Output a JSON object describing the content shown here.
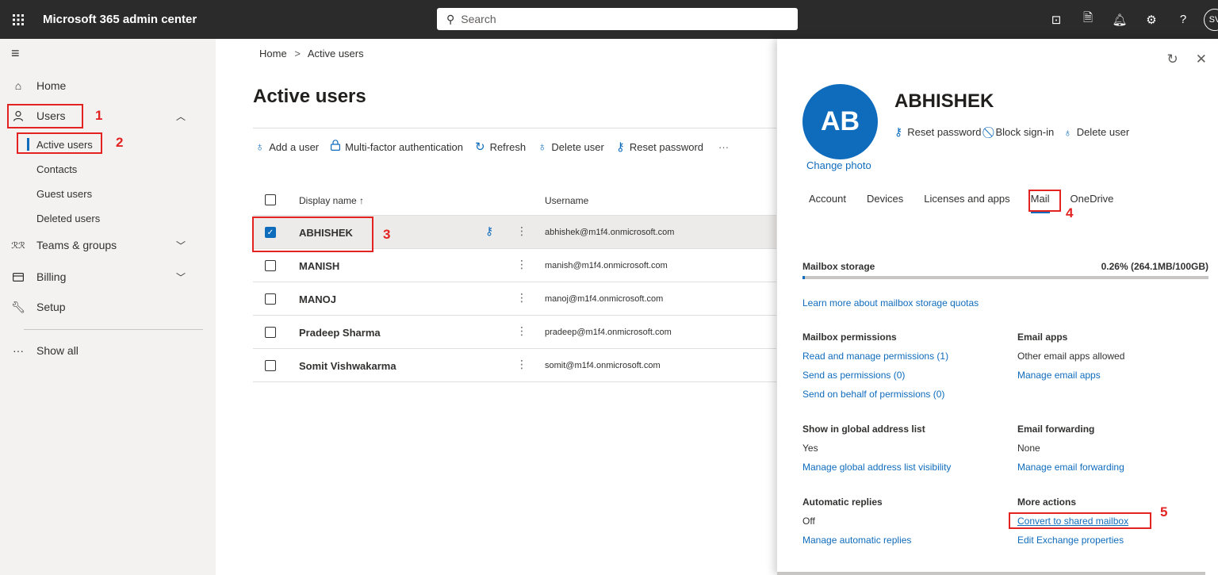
{
  "app": {
    "title": "Microsoft 365 admin center",
    "avatar_initials": "SV"
  },
  "search": {
    "placeholder": "Search"
  },
  "nav": {
    "home": "Home",
    "users": "Users",
    "sub": [
      "Active users",
      "Contacts",
      "Guest users",
      "Deleted users"
    ],
    "teams": "Teams & groups",
    "billing": "Billing",
    "setup": "Setup",
    "show_all": "Show all"
  },
  "annotations": [
    "1",
    "2",
    "3",
    "4",
    "5"
  ],
  "breadcrumb": {
    "home": "Home",
    "sep": ">",
    "current": "Active users"
  },
  "page": {
    "title": "Active users"
  },
  "toolbar": {
    "add_user": "Add a user",
    "mfa": "Multi-factor authentication",
    "refresh": "Refresh",
    "delete_user": "Delete user",
    "reset_password": "Reset password",
    "more": "···"
  },
  "table": {
    "columns": {
      "display_name": "Display name ↑",
      "username": "Username"
    },
    "rows": [
      {
        "name": "ABHISHEK",
        "username": "abhishek@m1f4.onmicrosoft.com",
        "checked": true
      },
      {
        "name": "MANISH",
        "username": "manish@m1f4.onmicrosoft.com",
        "checked": false
      },
      {
        "name": "MANOJ",
        "username": "manoj@m1f4.onmicrosoft.com",
        "checked": false
      },
      {
        "name": "Pradeep Sharma",
        "username": "pradeep@m1f4.onmicrosoft.com",
        "checked": false
      },
      {
        "name": "Somit Vishwakarma",
        "username": "somit@m1f4.onmicrosoft.com",
        "checked": false
      }
    ]
  },
  "panel": {
    "initials": "AB",
    "name": "ABHISHEK",
    "change_photo": "Change photo",
    "actions": {
      "reset_password": "Reset password",
      "block_signin": "Block sign-in",
      "delete_user": "Delete user"
    },
    "tabs": [
      "Account",
      "Devices",
      "Licenses and apps",
      "Mail",
      "OneDrive"
    ],
    "active_tab": "Mail",
    "mailbox_storage": {
      "label": "Mailbox storage",
      "value": "0.26% (264.1MB/100GB)",
      "fraction": 0.0026
    },
    "learn_more": "Learn more about mailbox storage quotas",
    "mailbox_permissions": {
      "label": "Mailbox permissions",
      "links": [
        "Read and manage permissions (1)",
        "Send as permissions (0)",
        "Send on behalf of permissions (0)"
      ]
    },
    "email_apps": {
      "label": "Email apps",
      "value": "Other email apps allowed",
      "link": "Manage email apps"
    },
    "gal": {
      "label": "Show in global address list",
      "value": "Yes",
      "link": "Manage global address list visibility"
    },
    "forwarding": {
      "label": "Email forwarding",
      "value": "None",
      "link": "Manage email forwarding"
    },
    "auto_replies": {
      "label": "Automatic replies",
      "value": "Off",
      "link": "Manage automatic replies"
    },
    "more_actions": {
      "label": "More actions",
      "convert": "Convert to shared mailbox",
      "edit_exchange": "Edit Exchange properties"
    }
  },
  "colors": {
    "accent": "#0f6cbd",
    "topbar": "#2b2b2b",
    "annotation": "#e32222"
  }
}
